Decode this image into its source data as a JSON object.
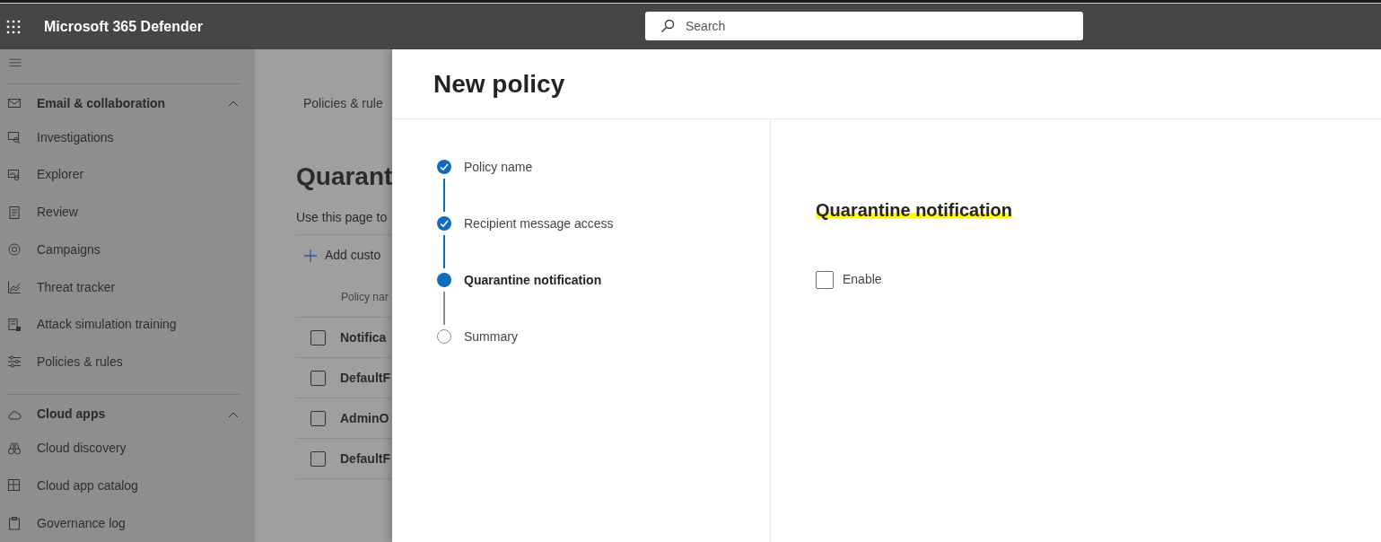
{
  "app": {
    "title": "Microsoft 365 Defender"
  },
  "search": {
    "placeholder": "Search"
  },
  "sidebar": {
    "sections": [
      {
        "label": "Email & collaboration",
        "expanded": true,
        "items": [
          {
            "label": "Investigations"
          },
          {
            "label": "Explorer"
          },
          {
            "label": "Review"
          },
          {
            "label": "Campaigns"
          },
          {
            "label": "Threat tracker"
          },
          {
            "label": "Attack simulation training"
          },
          {
            "label": "Policies & rules"
          }
        ]
      },
      {
        "label": "Cloud apps",
        "expanded": true,
        "items": [
          {
            "label": "Cloud discovery"
          },
          {
            "label": "Cloud app catalog"
          },
          {
            "label": "Governance log"
          }
        ]
      }
    ]
  },
  "background_page": {
    "breadcrumb": "Policies & rule",
    "title": "Quarant",
    "description": "Use this page to",
    "add_button": "Add custo",
    "column_header": "Policy nar",
    "rows": [
      {
        "name": "Notifica",
        "checked": false
      },
      {
        "name": "DefaultF",
        "checked": false
      },
      {
        "name": "AdminO",
        "checked": false
      },
      {
        "name": "DefaultF",
        "checked": false
      }
    ]
  },
  "panel": {
    "title": "New policy",
    "steps": [
      {
        "label": "Policy name",
        "completed": true,
        "selected": false
      },
      {
        "label": "Recipient message access",
        "completed": true,
        "selected": false
      },
      {
        "label": "Quarantine notification",
        "completed": false,
        "selected": true
      },
      {
        "label": "Summary",
        "completed": false,
        "selected": false
      }
    ],
    "section_title": "Quarantine notification",
    "enable": {
      "label": "Enable",
      "checked": false
    }
  }
}
